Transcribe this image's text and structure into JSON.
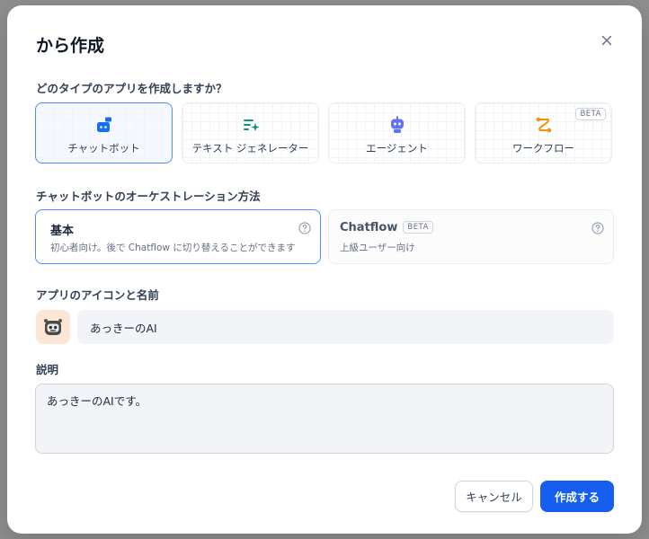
{
  "dialog": {
    "title": "から作成",
    "question": "どのタイプのアプリを作成しますか？",
    "app_types": [
      {
        "label": "チャットボット",
        "icon": "chatbot-icon",
        "selected": true
      },
      {
        "label": "テキスト ジェネレーター",
        "icon": "text-generator-icon",
        "selected": false
      },
      {
        "label": "エージェント",
        "icon": "agent-icon",
        "selected": false
      },
      {
        "label": "ワークフロー",
        "icon": "workflow-icon",
        "selected": false,
        "badge": "BETA"
      }
    ],
    "orchestration_heading": "チャットボットのオーケストレーション方法",
    "modes": [
      {
        "title": "基本",
        "description": "初心者向け。後で Chatflow に切り替えることができます",
        "selected": true
      },
      {
        "title": "Chatflow",
        "badge": "BETA",
        "description": "上級ユーザー向け",
        "selected": false
      }
    ],
    "icon_name_heading": "アプリのアイコンと名前",
    "app_name_value": "あっきーのAI",
    "description_heading": "説明",
    "description_value": "あっきーのAIです。",
    "cancel_label": "キャンセル",
    "create_label": "作成する"
  },
  "colors": {
    "accent": "#155eef",
    "selected_border": "#528bff",
    "avatar_bg": "#fde6d4",
    "chatbot_icon": "#1570ef",
    "text_generator_icon": "#0e9384",
    "agent_icon": "#6172f3",
    "workflow_icon": "#f79009"
  }
}
